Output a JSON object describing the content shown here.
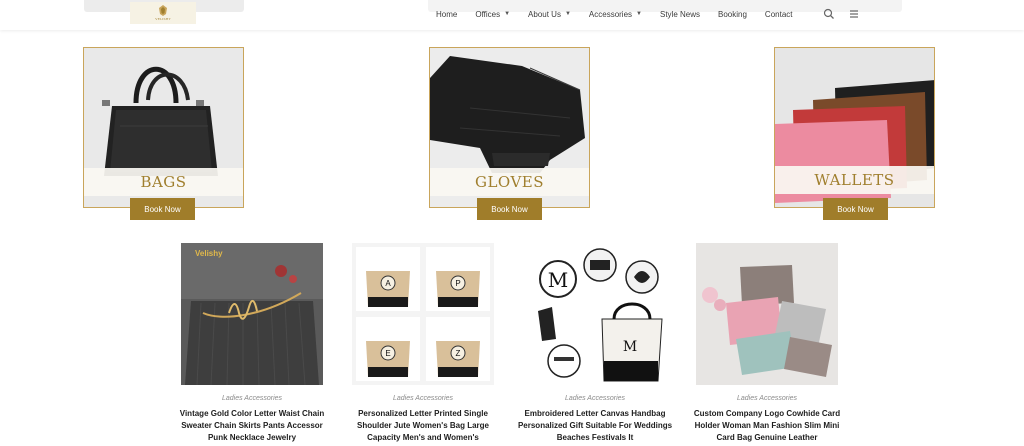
{
  "header": {
    "logo_text": "VELISHY",
    "nav": [
      {
        "label": "Home",
        "dropdown": false
      },
      {
        "label": "Offices",
        "dropdown": true
      },
      {
        "label": "About Us",
        "dropdown": true
      },
      {
        "label": "Accessories",
        "dropdown": true
      },
      {
        "label": "Style News",
        "dropdown": false
      },
      {
        "label": "Booking",
        "dropdown": false
      },
      {
        "label": "Contact",
        "dropdown": false
      }
    ],
    "icons": [
      "search-icon",
      "menu-icon"
    ]
  },
  "categories": [
    {
      "title": "BAGS",
      "button": "Book Now"
    },
    {
      "title": "GLOVES",
      "button": "Book Now"
    },
    {
      "title": "WALLETS",
      "button": "Book Now"
    }
  ],
  "products": [
    {
      "category": "Ladies Accessories",
      "title": "Vintage Gold Color Letter Waist Chain Sweater Chain Skirts Pants Accessor Punk Necklace Jewelry",
      "image_label": "Velishy"
    },
    {
      "category": "Ladies Accessories",
      "title": "Personalized Letter Printed Single Shoulder Jute Women's Bag Large Capacity Men's and Women's"
    },
    {
      "category": "Ladies Accessories",
      "title": "Embroidered Letter Canvas Handbag Personalized Gift Suitable For Weddings Beaches Festivals It"
    },
    {
      "category": "Ladies Accessories",
      "title": "Custom Company Logo Cowhide Card Holder Woman Man Fashion Slim Mini Card Bag Genuine Leather"
    }
  ],
  "colors": {
    "accent": "#a07d2a",
    "gold_text": "#a07f2e",
    "card_border": "#c9a55b"
  }
}
